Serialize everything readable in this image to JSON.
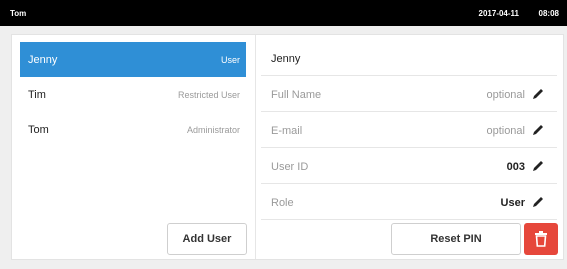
{
  "status_bar": {
    "current_user": "Tom",
    "date": "2017-04-11",
    "time": "08:08"
  },
  "users": [
    {
      "name": "Jenny",
      "role": "User",
      "selected": true
    },
    {
      "name": "Tim",
      "role": "Restricted User",
      "selected": false
    },
    {
      "name": "Tom",
      "role": "Administrator",
      "selected": false
    }
  ],
  "add_user_label": "Add User",
  "details": {
    "title": "Jenny",
    "fields": [
      {
        "label": "Full Name",
        "value": "optional",
        "placeholder": true
      },
      {
        "label": "E-mail",
        "value": "optional",
        "placeholder": true
      },
      {
        "label": "User ID",
        "value": "003",
        "placeholder": false
      },
      {
        "label": "Role",
        "value": "User",
        "placeholder": false
      }
    ],
    "edit_icon": "pencil-icon"
  },
  "reset_pin_label": "Reset PIN",
  "delete_icon": "trash-icon",
  "colors": {
    "accent": "#2f8fd6",
    "danger": "#e6473b",
    "topbar": "#000000"
  }
}
